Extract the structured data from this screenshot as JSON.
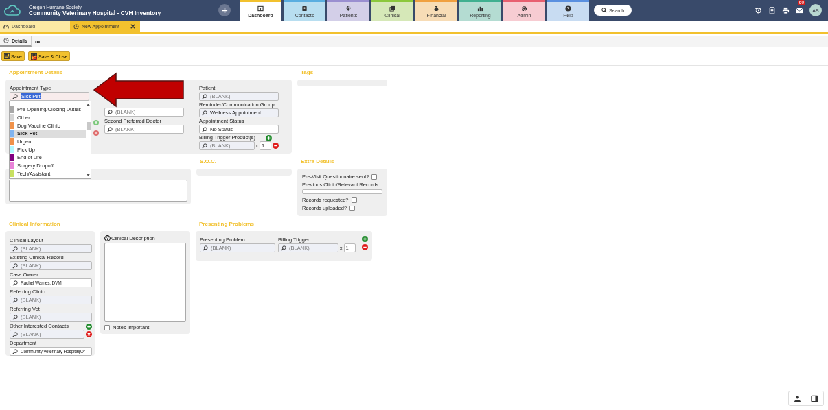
{
  "header": {
    "org": "Oregon Humane Society",
    "title": "Community Veterinary Hospital - CVH Inventory",
    "nav": [
      {
        "label": "Dashboard",
        "color": "#ffffff",
        "selected": true
      },
      {
        "label": "Contacts",
        "color": "#b8def0",
        "selected": false
      },
      {
        "label": "Patients",
        "color": "#d3cfe8",
        "selected": false
      },
      {
        "label": "Clinical",
        "color": "#d6e8b8",
        "selected": false
      },
      {
        "label": "Financial",
        "color": "#f7dcb6",
        "selected": false
      },
      {
        "label": "Reporting",
        "color": "#b4dcd2",
        "selected": false
      },
      {
        "label": "Admin",
        "color": "#f7ccd2",
        "selected": false
      },
      {
        "label": "Help",
        "color": "#c8dcf2",
        "selected": false
      }
    ],
    "search": "Search",
    "mail_count": "60",
    "avatar": "AS"
  },
  "doc_tabs": [
    {
      "label": "Dashboard",
      "selected": false,
      "closable": false
    },
    {
      "label": "New Appointment",
      "selected": true,
      "closable": true
    }
  ],
  "sub_tabs": [
    {
      "label": "Details",
      "selected": true
    },
    {
      "label": "•••",
      "selected": false
    }
  ],
  "toolbar": [
    {
      "label": "Save",
      "kind": "save"
    },
    {
      "label": "Save & Close",
      "kind": "save-close"
    }
  ],
  "appointment": {
    "title": "Appointment Details",
    "type_field": {
      "label": "Appointment Type",
      "value": "Sick Pet"
    },
    "middle": [
      {
        "placeholder": "(BLANK)"
      },
      {
        "label": "Second Preferred Doctor",
        "placeholder": "(BLANK)"
      }
    ],
    "right": [
      {
        "label": "Patient",
        "placeholder": "(BLANK)",
        "disabled": true
      },
      {
        "label": "Reminder/Communication Group",
        "value": "Wellness Appointment",
        "disabled": true
      },
      {
        "label": "Appointment Status",
        "value": "No Status",
        "disabled": false
      },
      {
        "label": "Billing Trigger Product(s)",
        "placeholder": "(BLANK)",
        "disabled": true,
        "times": "x",
        "qty": "1",
        "add": true,
        "remove": true
      }
    ]
  },
  "type_options": [
    {
      "label": "Pre-Opening/Closing Duties",
      "color": "#a8a8a8",
      "selected": false
    },
    {
      "label": "Other",
      "color": "#d4d4d4",
      "selected": false
    },
    {
      "label": "Dog Vaccine Clinic",
      "color": "#f0924a",
      "selected": false
    },
    {
      "label": "Sick Pet",
      "color": "#80b4f0",
      "selected": true
    },
    {
      "label": "Urgent",
      "color": "#f0924a",
      "selected": false
    },
    {
      "label": "Pick Up",
      "color": "#b0f8ff",
      "selected": false
    },
    {
      "label": "End of Life",
      "color": "#800080",
      "selected": false
    },
    {
      "label": "Surgery Dropoff",
      "color": "#e882d8",
      "selected": false
    },
    {
      "label": "Tech/Assistant",
      "color": "#c8e060",
      "selected": false
    }
  ],
  "tags": {
    "title": "Tags"
  },
  "soc": {
    "title": "S.O.C."
  },
  "extra": {
    "title": "Extra Details",
    "items": [
      {
        "kind": "check",
        "label": "Pre-Visit Questionnaire sent?",
        "checked": false
      },
      {
        "kind": "text",
        "label": "Previous Clinic/Relevant Records:"
      },
      {
        "kind": "check",
        "label": "Records requested?",
        "checked": false
      },
      {
        "kind": "check",
        "label": "Records uploaded?",
        "checked": false
      }
    ]
  },
  "clinical": {
    "title": "Clinical Information",
    "fields": [
      {
        "label": "Clinical Layout",
        "placeholder": "(BLANK)",
        "disabled": true
      },
      {
        "label": "Existing Clinical Record",
        "placeholder": "(BLANK)",
        "disabled": true
      },
      {
        "label": "Case Owner",
        "value": "Rachel Warnes, DVM",
        "disabled": false
      },
      {
        "label": "Referring Clinic",
        "placeholder": "(BLANK)",
        "disabled": true
      },
      {
        "label": "Referring Vet",
        "placeholder": "(BLANK)",
        "disabled": true
      },
      {
        "label": "Other Interested Contacts",
        "placeholder": "(BLANK)",
        "disabled": true,
        "add": true,
        "delete": true
      },
      {
        "label": "Department",
        "value": "Community Veterinary Hospital(Or",
        "disabled": false
      }
    ],
    "description_label": "Clinical Description",
    "notes": {
      "label": "Notes Important",
      "checked": false
    }
  },
  "presenting": {
    "title": "Presenting Problems",
    "problem": {
      "label": "Presenting Problem",
      "placeholder": "(BLANK)"
    },
    "trigger": {
      "label": "Billing Trigger",
      "placeholder": "(BLANK)",
      "times": "x",
      "qty": "1"
    }
  }
}
